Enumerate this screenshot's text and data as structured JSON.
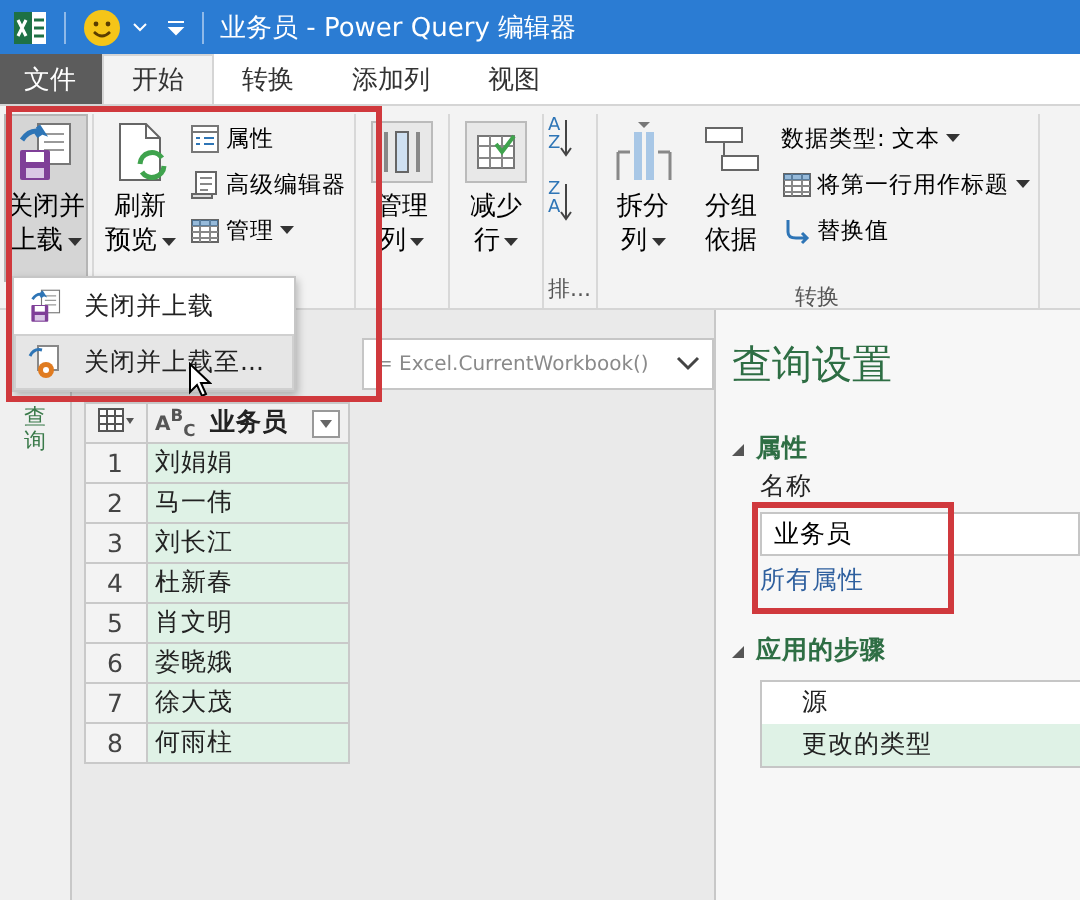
{
  "window": {
    "title": "业务员 - Power Query 编辑器"
  },
  "tabs": [
    {
      "label": "文件",
      "kind": "file",
      "selected": false
    },
    {
      "label": "开始",
      "kind": "tab",
      "selected": true
    },
    {
      "label": "转换",
      "kind": "tab",
      "selected": false
    },
    {
      "label": "添加列",
      "kind": "tab",
      "selected": false
    },
    {
      "label": "视图",
      "kind": "tab",
      "selected": false
    }
  ],
  "ribbon": {
    "groups": [
      {
        "items": [
          {
            "kind": "large",
            "lines": [
              "关闭并",
              "上载"
            ],
            "dropdown": true,
            "pressed": true
          }
        ]
      },
      {
        "items": [
          {
            "kind": "large",
            "lines": [
              "刷新",
              "预览"
            ],
            "dropdown": true,
            "pressed": false
          },
          {
            "kind": "small",
            "label": "属性",
            "dropdown": false
          },
          {
            "kind": "small",
            "label": "高级编辑器",
            "dropdown": false
          },
          {
            "kind": "small",
            "label": "管理",
            "dropdown": true
          }
        ]
      },
      {
        "items": [
          {
            "kind": "large",
            "lines": [
              "管理",
              "列"
            ],
            "dropdown": true,
            "pressed": false
          }
        ]
      },
      {
        "items": [
          {
            "kind": "large",
            "lines": [
              "减少",
              "行"
            ],
            "dropdown": true,
            "pressed": false
          }
        ]
      },
      {
        "label": "排...",
        "items": [
          {
            "kind": "sort",
            "letters": [
              "A",
              "Z"
            ]
          },
          {
            "kind": "sort",
            "letters": [
              "Z",
              "A"
            ]
          }
        ]
      },
      {
        "label": "转换",
        "items": [
          {
            "kind": "large",
            "lines": [
              "拆分",
              "列"
            ],
            "dropdown": true,
            "pressed": false
          },
          {
            "kind": "large",
            "lines": [
              "分组",
              "依据"
            ],
            "dropdown": false,
            "pressed": false
          },
          {
            "kind": "small",
            "label": "数据类型: 文本",
            "dropdown": true
          },
          {
            "kind": "small",
            "label": "将第一行用作标题",
            "dropdown": true
          },
          {
            "kind": "small",
            "label": "替换值",
            "dropdown": false
          }
        ]
      }
    ]
  },
  "menu": {
    "items": [
      {
        "label": "关闭并上载",
        "selected": false
      },
      {
        "label": "关闭并上载至...",
        "selected": true
      }
    ]
  },
  "queries_pane": {
    "label": "查询"
  },
  "formula_bar": {
    "text": "= Excel.CurrentWorkbook()"
  },
  "table": {
    "type_label": "A$^{B}$$_{C}$",
    "columns": [
      {
        "label": "业务员"
      }
    ],
    "rows": [
      {
        "index": "1",
        "cells": [
          "刘娟娟"
        ]
      },
      {
        "index": "2",
        "cells": [
          "马一伟"
        ]
      },
      {
        "index": "3",
        "cells": [
          "刘长江"
        ]
      },
      {
        "index": "4",
        "cells": [
          "杜新春"
        ]
      },
      {
        "index": "5",
        "cells": [
          "肖文明"
        ]
      },
      {
        "index": "6",
        "cells": [
          "娄晓娥"
        ]
      },
      {
        "index": "7",
        "cells": [
          "徐大茂"
        ]
      },
      {
        "index": "8",
        "cells": [
          "何雨柱"
        ]
      }
    ]
  },
  "query_settings": {
    "title": "查询设置",
    "properties": {
      "heading": "属性",
      "name_label": "名称",
      "name_value": "业务员",
      "link": "所有属性"
    },
    "steps": {
      "heading": "应用的步骤",
      "items": [
        {
          "label": "源",
          "selected": false
        },
        {
          "label": "更改的类型",
          "selected": true
        }
      ]
    }
  }
}
